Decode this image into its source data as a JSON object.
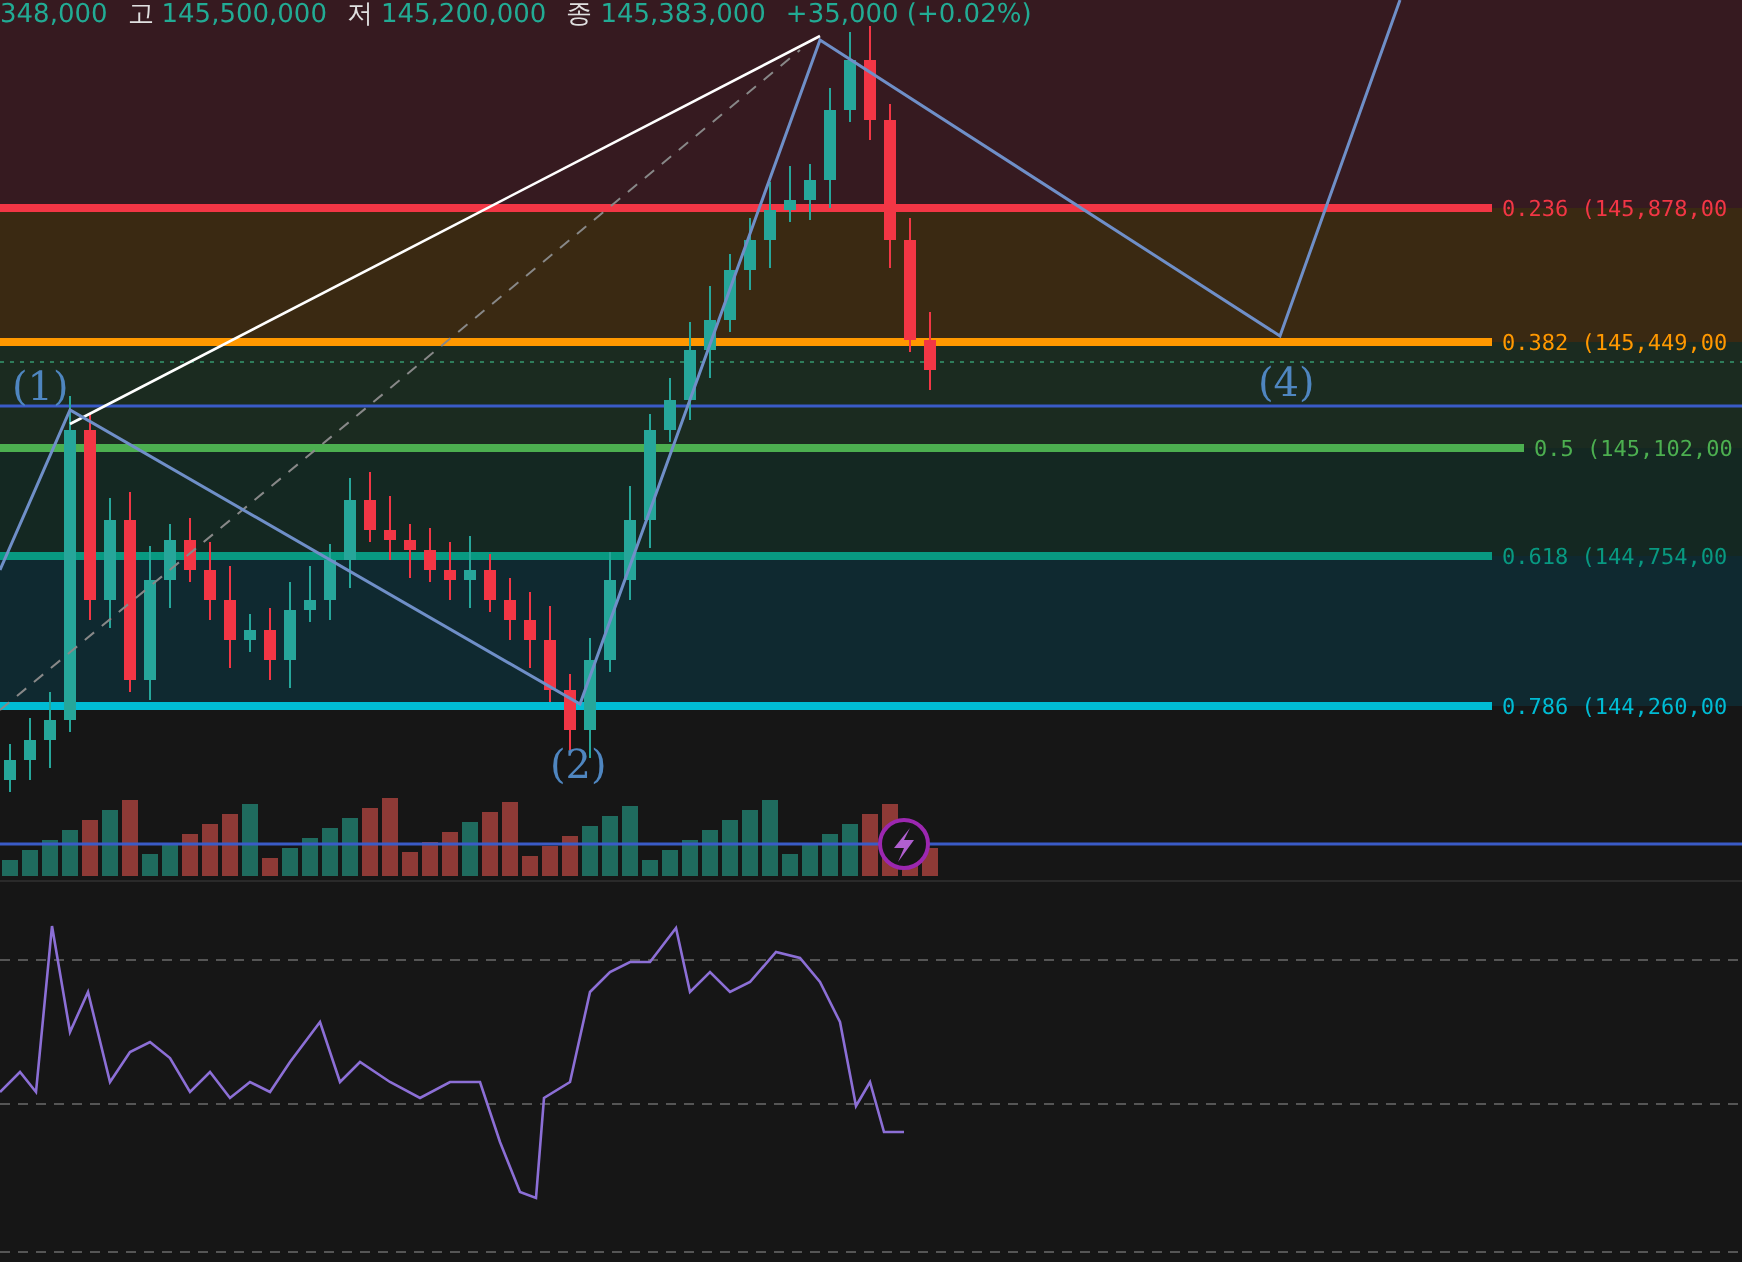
{
  "header": {
    "open_value": "348,000",
    "fields": [
      {
        "label": "고",
        "value": "145,500,000"
      },
      {
        "label": "저",
        "value": "145,200,000"
      },
      {
        "label": "종",
        "value": "145,383,000"
      }
    ],
    "change": "+35,000 (+0.02%)"
  },
  "fib_levels": [
    {
      "ratio": "0.236",
      "price": "(145,878,00",
      "color": "#f23645"
    },
    {
      "ratio": "0.382",
      "price": "(145,449,00",
      "color": "#ff9800"
    },
    {
      "ratio": "0.5",
      "price": "(145,102,00",
      "color": "#4caf50"
    },
    {
      "ratio": "0.618",
      "price": "(144,754,00",
      "color": "#089981"
    },
    {
      "ratio": "0.786",
      "price": "(144,260,00",
      "color": "#00bcd4"
    }
  ],
  "wave_labels": [
    "(1)",
    "(2)",
    "(4)"
  ]
}
